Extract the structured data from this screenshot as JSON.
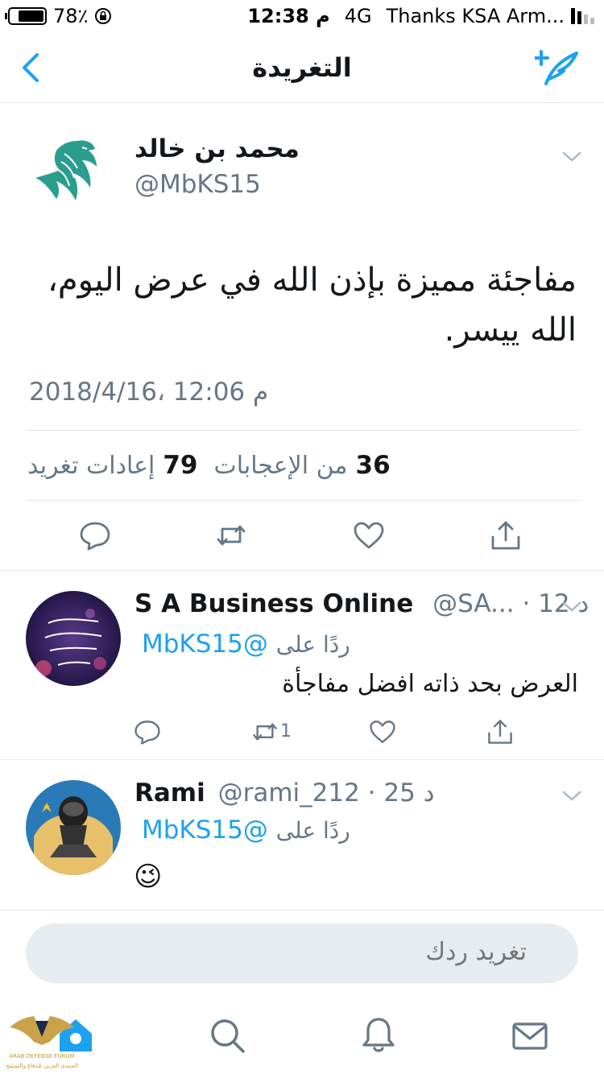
{
  "status_bar": {
    "battery": "78٪",
    "time": "12:38 م",
    "network": "4G",
    "carrier": "Thanks KSA Arm..."
  },
  "nav": {
    "title": "التغريدة"
  },
  "main_tweet": {
    "name": "محمد بن خالد",
    "handle": "@MbKS15",
    "text": "مفاجئة مميزة بإذن الله في عرض اليوم، الله ييسر.",
    "timestamp": "2018/4/16، 12:06 م",
    "likes_count": "36",
    "likes_label": "من الإعجابات",
    "retweets_count": "79",
    "retweets_label": "إعادات تغريد"
  },
  "replies": [
    {
      "name": "S A Business Online",
      "handle": "@SA...",
      "time": "12 د",
      "reply_label": "ردًا على",
      "reply_to": "@MbKS15",
      "text": "العرض بحد ذاته افضل مفاجأة",
      "retweet_count": "1"
    },
    {
      "name": "Rami",
      "handle": "@rami_212",
      "time": "25 د",
      "reply_label": "ردًا على",
      "reply_to": "@MbKS15",
      "text": "😉"
    }
  ],
  "composer": {
    "placeholder": "تغريد ردك"
  },
  "watermark": {
    "line1": "ARAB DEFENSE FORUM",
    "line2": "المنتدى العربي للدفاع والتسليح"
  },
  "colors": {
    "accent": "#1da1f2",
    "secondary_text": "#657786",
    "divider": "#e1e8ed",
    "composer_bg": "#e6ecf0"
  }
}
